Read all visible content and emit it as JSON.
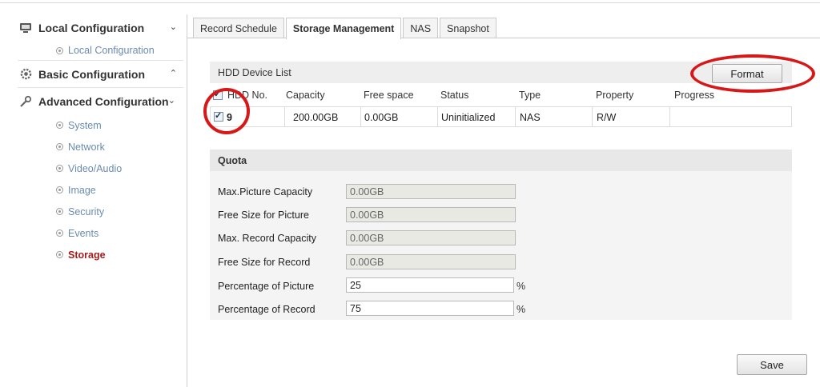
{
  "sidebar": {
    "sections": [
      {
        "title": "Local Configuration",
        "icon": "monitor-icon",
        "chevron": "⌄"
      },
      {
        "title": "Basic Configuration",
        "icon": "gear-icon",
        "chevron": "⌃"
      },
      {
        "title": "Advanced Configuration",
        "icon": "wrench-icon",
        "chevron": "⌄"
      }
    ],
    "local_items": [
      "Local Configuration"
    ],
    "advanced_items": [
      "System",
      "Network",
      "Video/Audio",
      "Image",
      "Security",
      "Events",
      "Storage"
    ],
    "active_item": "Storage"
  },
  "tabs": [
    "Record Schedule",
    "Storage Management",
    "NAS",
    "Snapshot"
  ],
  "active_tab": "Storage Management",
  "hdd": {
    "title": "HDD Device List",
    "format_label": "Format",
    "columns": [
      "HDD No.",
      "Capacity",
      "Free space",
      "Status",
      "Type",
      "Property",
      "Progress"
    ],
    "rows": [
      {
        "checked": true,
        "hdd_no": "9",
        "capacity": "200.00GB",
        "free_space": "0.00GB",
        "status": "Uninitialized",
        "type": "NAS",
        "property": "R/W",
        "progress": ""
      }
    ]
  },
  "quota": {
    "title": "Quota",
    "fields": [
      {
        "label": "Max.Picture Capacity",
        "value": "0.00GB",
        "readonly": true
      },
      {
        "label": "Free Size for Picture",
        "value": "0.00GB",
        "readonly": true
      },
      {
        "label": "Max. Record Capacity",
        "value": "0.00GB",
        "readonly": true
      },
      {
        "label": "Free Size for Record",
        "value": "0.00GB",
        "readonly": true
      },
      {
        "label": "Percentage of Picture",
        "value": "25",
        "readonly": false,
        "unit": "%"
      },
      {
        "label": "Percentage of Record",
        "value": "75",
        "readonly": false,
        "unit": "%"
      }
    ]
  },
  "save_label": "Save",
  "colors": {
    "active_nav": "#a51c1c",
    "nav_link": "#6b8bb1",
    "highlight_circle": "#d61818"
  }
}
